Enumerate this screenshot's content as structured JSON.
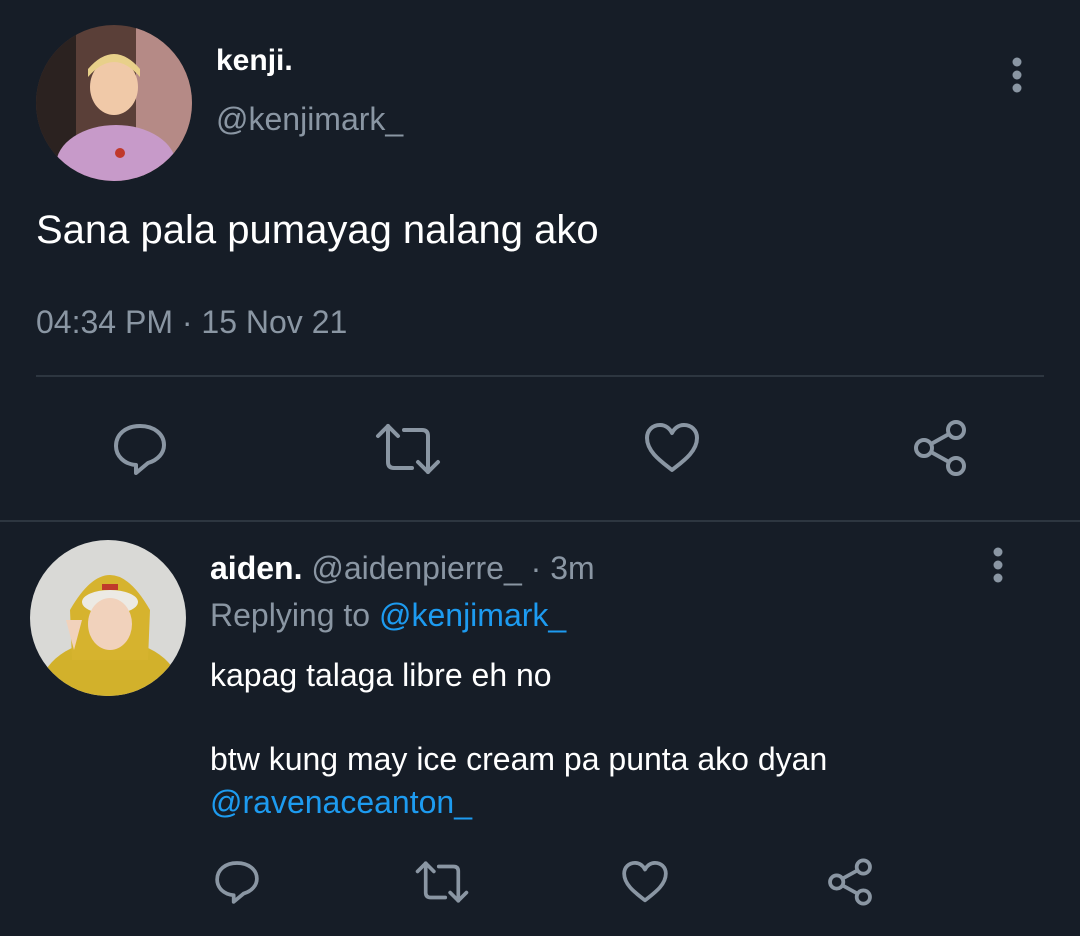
{
  "colors": {
    "background": "#161d27",
    "text": "#ffffff",
    "muted": "#8a96a3",
    "link": "#1d9bf0",
    "divider": "#2d3640"
  },
  "main_tweet": {
    "display_name": "kenji.",
    "handle": "@kenjimark_",
    "text": "Sana pala pumayag nalang ako",
    "time": "04:34 PM",
    "separator": "·",
    "date": "15 Nov 21",
    "actions": [
      "reply-icon",
      "retweet-icon",
      "like-icon",
      "share-icon"
    ]
  },
  "reply": {
    "display_name": "aiden.",
    "handle": "@aidenpierre_",
    "separator": "·",
    "age": "3m",
    "replying_prefix": "Replying to",
    "replying_handle": "@kenjimark_",
    "line1": "kapag talaga libre eh no",
    "line2": "btw kung may ice cream pa punta ako dyan",
    "mention": "@ravenaceanton_",
    "actions": [
      "reply-icon",
      "retweet-icon",
      "like-icon",
      "share-icon"
    ]
  }
}
